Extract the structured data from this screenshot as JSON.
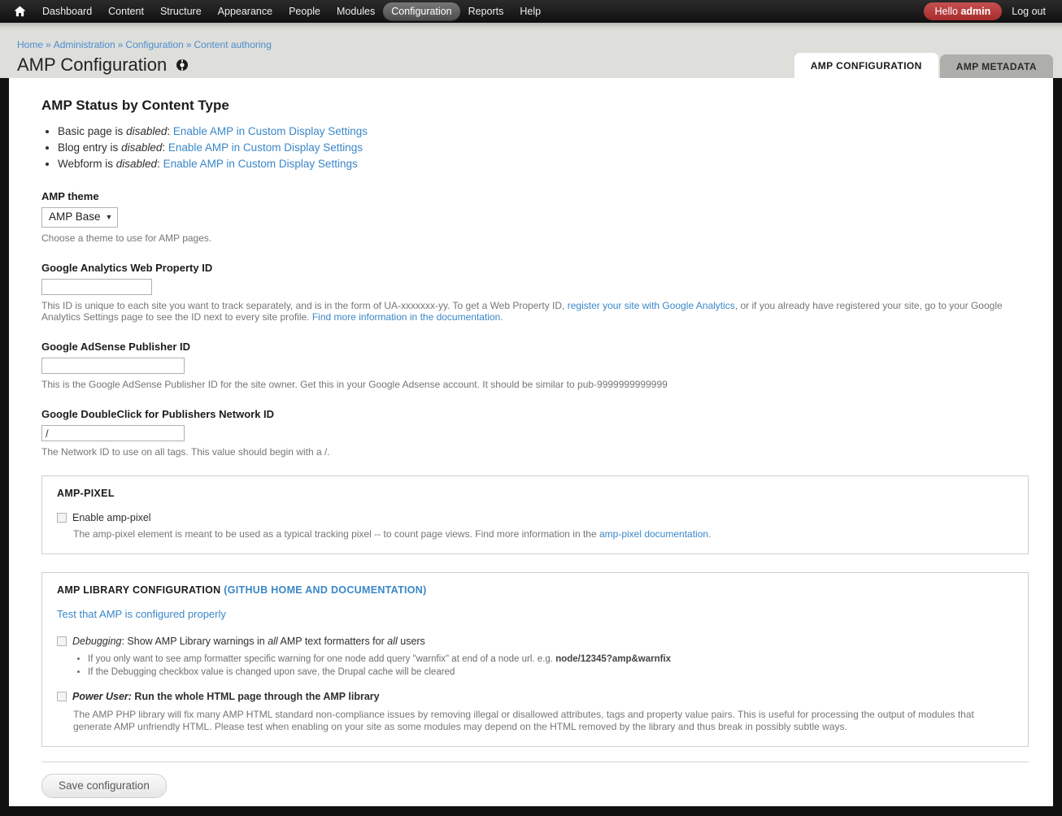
{
  "toolbar": {
    "home_icon": "home-icon",
    "items": [
      {
        "label": "Dashboard",
        "active": false
      },
      {
        "label": "Content",
        "active": false
      },
      {
        "label": "Structure",
        "active": false
      },
      {
        "label": "Appearance",
        "active": false
      },
      {
        "label": "People",
        "active": false
      },
      {
        "label": "Modules",
        "active": false
      },
      {
        "label": "Configuration",
        "active": true
      },
      {
        "label": "Reports",
        "active": false
      },
      {
        "label": "Help",
        "active": false
      }
    ],
    "hello_prefix": "Hello ",
    "hello_user": "admin",
    "logout_label": "Log out"
  },
  "breadcrumb": {
    "items": [
      "Home",
      "Administration",
      "Configuration",
      "Content authoring"
    ],
    "separator": "»"
  },
  "header": {
    "title": "AMP Configuration",
    "title_icon": "gear-icon"
  },
  "tabs": [
    {
      "label": "AMP CONFIGURATION",
      "active": true
    },
    {
      "label": "AMP METADATA",
      "active": false
    }
  ],
  "status_section": {
    "heading": "AMP Status by Content Type",
    "items": [
      {
        "type": "Basic page",
        "verb_prefix": " is ",
        "state": "disabled",
        "colon": ": ",
        "link": "Enable AMP in Custom Display Settings"
      },
      {
        "type": "Blog entry",
        "verb_prefix": " is ",
        "state": "disabled",
        "colon": ": ",
        "link": "Enable AMP in Custom Display Settings"
      },
      {
        "type": "Webform",
        "verb_prefix": " is ",
        "state": "disabled",
        "colon": ": ",
        "link": "Enable AMP in Custom Display Settings"
      }
    ]
  },
  "amp_theme": {
    "label": "AMP theme",
    "selected": "AMP Base",
    "caret": "▼",
    "options": [
      "AMP Base"
    ],
    "description": "Choose a theme to use for AMP pages."
  },
  "google_analytics": {
    "label": "Google Analytics Web Property ID",
    "value": "",
    "desc_part1": "This ID is unique to each site you want to track separately, and is in the form of UA-xxxxxxx-yy. To get a Web Property ID, ",
    "desc_link1": "register your site with Google Analytics",
    "desc_part2": ", or if you already have registered your site, go to your Google Analytics Settings page to see the ID next to every site profile. ",
    "desc_link2": "Find more information in the documentation."
  },
  "adsense": {
    "label": "Google AdSense Publisher ID",
    "value": "",
    "description": "This is the Google AdSense Publisher ID for the site owner. Get this in your Google Adsense account. It should be similar to pub-9999999999999"
  },
  "doubleclick": {
    "label": "Google DoubleClick for Publishers Network ID",
    "value": "/",
    "description": "The Network ID to use on all tags. This value should begin with a /."
  },
  "amp_pixel": {
    "title": "AMP-PIXEL",
    "checkbox_label": "Enable amp-pixel",
    "checked": false,
    "desc_part1": "The amp-pixel element is meant to be used as a typical tracking pixel -- to count page views. Find more information in the ",
    "desc_link": "amp-pixel documentation",
    "desc_part2": "."
  },
  "amp_library": {
    "title": "AMP LIBRARY CONFIGURATION ",
    "title_link": "(GITHUB HOME AND DOCUMENTATION)",
    "test_link": "Test that AMP is configured properly",
    "debugging": {
      "checked": false,
      "emphasis": "Debugging",
      "text_part1": ": Show AMP Library warnings in ",
      "emphasis2": "all",
      "text_part2": " AMP text formatters for ",
      "emphasis3": "all",
      "text_part3": " users",
      "bullets": [
        {
          "text_part1": "If you only want to see amp formatter specific warning for one node add query \"warnfix\" at end of a node url. e.g. ",
          "bold": "node/12345?amp&warnfix"
        },
        {
          "text_part1": "If the Debugging checkbox value is changed upon save, the Drupal cache will be cleared",
          "bold": ""
        }
      ]
    },
    "power_user": {
      "checked": false,
      "emphasis": "Power User:",
      "text": " Run the whole HTML page through the AMP library",
      "description": "The AMP PHP library will fix many AMP HTML standard non-compliance issues by removing illegal or disallowed attributes, tags and property value pairs. This is useful for processing the output of modules that generate AMP unfriendly HTML. Please test when enabling on your site as some modules may depend on the HTML removed by the library and thus break in possibly subtle ways."
    }
  },
  "actions": {
    "save_label": "Save configuration"
  },
  "colors": {
    "toolbar_bg": "#1a1a1a",
    "header_bg": "#dededa",
    "link_blue": "#3a87c8",
    "badge_red": "#a62d2c",
    "active_tab_bg": "#ffffff",
    "inactive_tab_bg": "#aeaeaa"
  }
}
